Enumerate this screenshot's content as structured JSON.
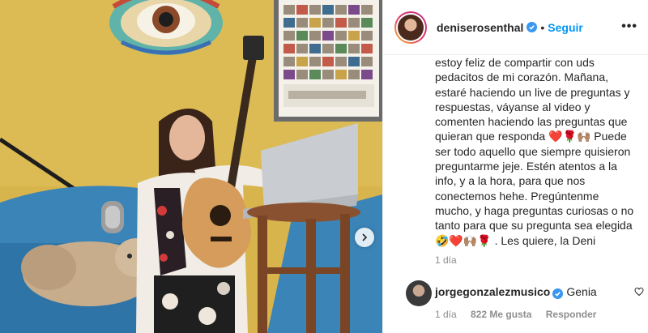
{
  "post": {
    "author": {
      "username": "deniserosenthal",
      "verified": true,
      "follow_label": "Seguir",
      "separator": "•",
      "more_label": "•••"
    },
    "caption_lines": [
      "estoy feliz de compartir con uds",
      "pedacitos de mi corazón. Mañana,",
      "estaré haciendo un live de preguntas y",
      "respuestas, váyanse al video y",
      "comenten haciendo las preguntas que",
      "quieran que responda ❤️🌹🙌🏽 Puede",
      "ser todo aquello que siempre quisieron",
      "preguntarme jeje. Estén atentos a la",
      "info, y a la hora, para que nos",
      "conectemos hehe. Pregúntenme",
      "mucho, y haga preguntas curiosas o no",
      "tanto para que su pregunta sea elegida",
      "🤣❤️🙌🏽🌹 . Les quiere, la Deni"
    ],
    "time_ago": "1 día"
  },
  "comments": [
    {
      "username": "jorgegonzalezmusico",
      "verified": true,
      "text": "Genia",
      "time_ago": "1 día",
      "likes_label": "822 Me gusta",
      "reply_label": "Responder"
    }
  ],
  "colors": {
    "accent": "#0095f6",
    "verified": "#3897f0",
    "muted": "#8e8e8e",
    "text": "#262626",
    "wall": "#d9b64a",
    "sofa": "#3b84b7"
  },
  "icons": {
    "next": "chevron-right-icon",
    "more": "ellipsis-icon",
    "verified": "verified-badge-icon",
    "like": "heart-outline-icon"
  }
}
